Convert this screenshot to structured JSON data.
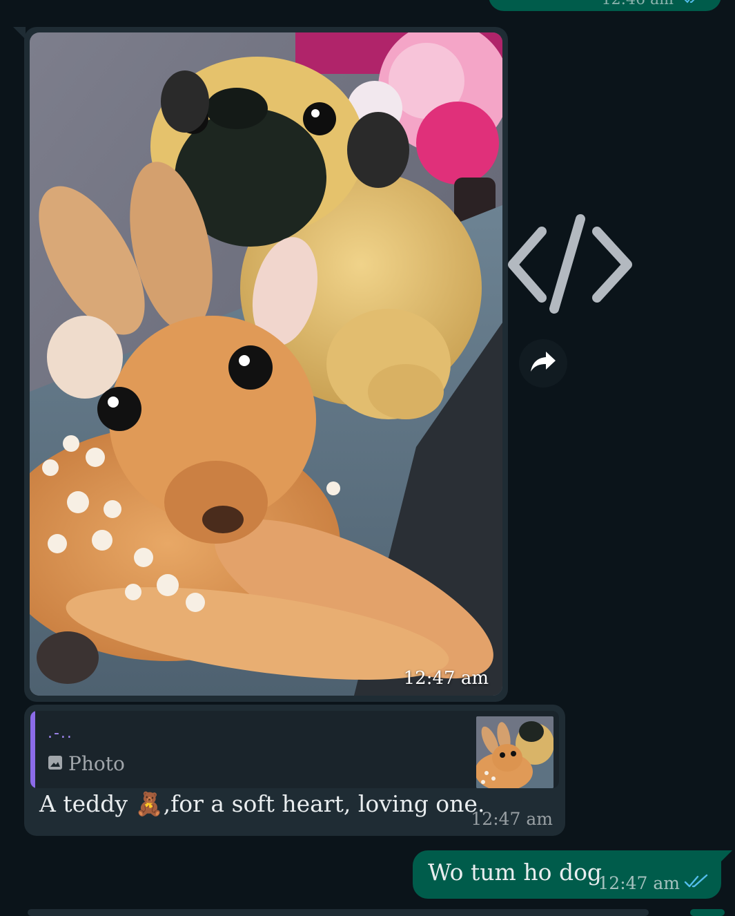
{
  "colors": {
    "background": "#0b141a",
    "incoming_bubble": "#1f2c34",
    "outgoing_bubble": "#005c4b",
    "read_ticks": "#53bdeb",
    "quote_accent": "#8b6be8"
  },
  "top_message": {
    "time": "12:46 am",
    "ticks_icon": "double-check-icon"
  },
  "image_message": {
    "time": "12:47 am"
  },
  "overlay": {
    "code_icon": "code-icon",
    "forward_icon": "forward-arrow-icon"
  },
  "reply_message": {
    "quoted_author": ".-..",
    "quoted_type_label": "Photo",
    "quoted_type_icon": "image-icon",
    "text": "A teddy 🧸,for a soft heart, loving one.",
    "time": "12:47 am"
  },
  "outgoing_message": {
    "text": "Wo tum ho dog",
    "time": "12:47 am",
    "ticks_icon": "double-check-icon"
  }
}
